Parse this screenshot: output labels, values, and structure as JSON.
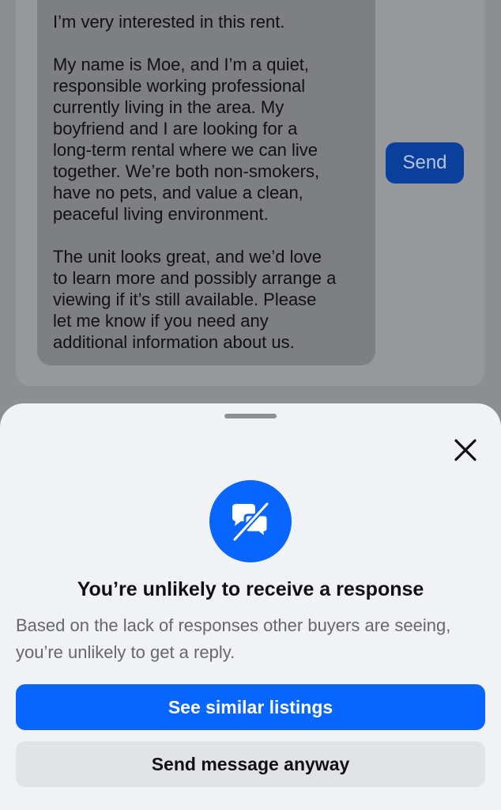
{
  "message": {
    "paragraphs": [
      "I’m very interested in this rent.",
      "My name is Moe, and I’m a quiet,\nresponsible working professional\ncurrently living in the area. My\nboyfriend and I are looking for a\nlong-term rental where we can live\ntogether. We’re both non-smokers,\nhave no pets, and value a clean,\npeaceful living environment.",
      "The unit looks great, and we’d love\nto learn more and possibly arrange a\nviewing if it’s still available. Please\nlet me know if you need any\nadditional information about us."
    ],
    "send_label": "Send"
  },
  "sheet": {
    "icon": "chat-off-icon",
    "close_icon": "close-icon",
    "title": "You’re unlikely to receive a response",
    "body": "Based on the lack of responses other buyers are seeing, you’re unlikely to get a reply.",
    "primary_label": "See similar listings",
    "secondary_label": "Send message anyway"
  },
  "colors": {
    "accent": "#0866ff",
    "overlay": "#8d8e91",
    "sheet_background": "#f1f2f6",
    "secondary_button": "#e2e3e7"
  }
}
